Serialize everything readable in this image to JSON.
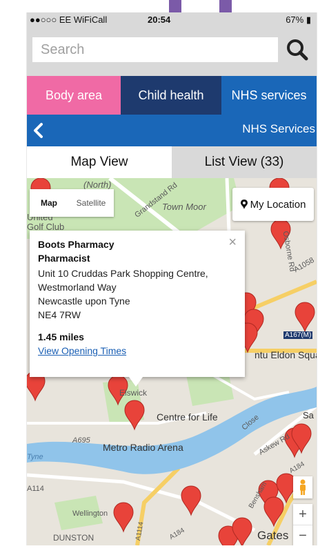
{
  "status_bar": {
    "carrier": "●●○○○ EE WiFiCall",
    "time": "20:54",
    "battery": "67%"
  },
  "search": {
    "placeholder": "Search",
    "icon": "search-icon"
  },
  "categories": [
    {
      "label": "Body area",
      "color": "#f06aa5"
    },
    {
      "label": "Child health",
      "color": "#1e3a6e"
    },
    {
      "label": "NHS services",
      "color": "#1a67b8"
    }
  ],
  "nav": {
    "back_icon": "chevron-left-icon",
    "title": "NHS Services"
  },
  "view_tabs": {
    "map": "Map View",
    "list": "List View (33)"
  },
  "map": {
    "type_map": "Map",
    "type_satellite": "Satellite",
    "my_location": "My Location",
    "labels": {
      "north": "(North)",
      "grandstand": "Grandstand Rd",
      "town_moor": "Town Moor",
      "golf": "United Golf Club",
      "osborne": "Osborne Rd",
      "a1058": "A1058",
      "a167m": "A167(M)",
      "eldon": "ntu Eldon Squar",
      "elswick": "Elswick",
      "centre_for_life": "Centre for Life",
      "close": "Close",
      "sa": "Sa",
      "a695": "A695",
      "metro_radio": "Metro Radio Arena",
      "askew": "Askew Rd",
      "a184": "A184",
      "a184b": "A184",
      "tyne": "Tyne",
      "a114": "A114",
      "wellington": "Wellington",
      "benshams": "Bensham",
      "dunston": "DUNSTON",
      "a1114": "A1114",
      "gates": "Gates"
    },
    "info_window": {
      "name": "Boots Pharmacy",
      "type": "Pharmacist",
      "address": [
        "Unit 10 Cruddas Park Shopping Centre,",
        "Westmorland Way",
        "Newcastle upon Tyne",
        "NE4 7RW"
      ],
      "distance": "1.45 miles",
      "opening_link": "View Opening Times"
    }
  },
  "colors": {
    "pink": "#f06aa5",
    "navy": "#1e3a6e",
    "nhs_blue": "#1a67b8",
    "pin_red": "#e8433a"
  }
}
